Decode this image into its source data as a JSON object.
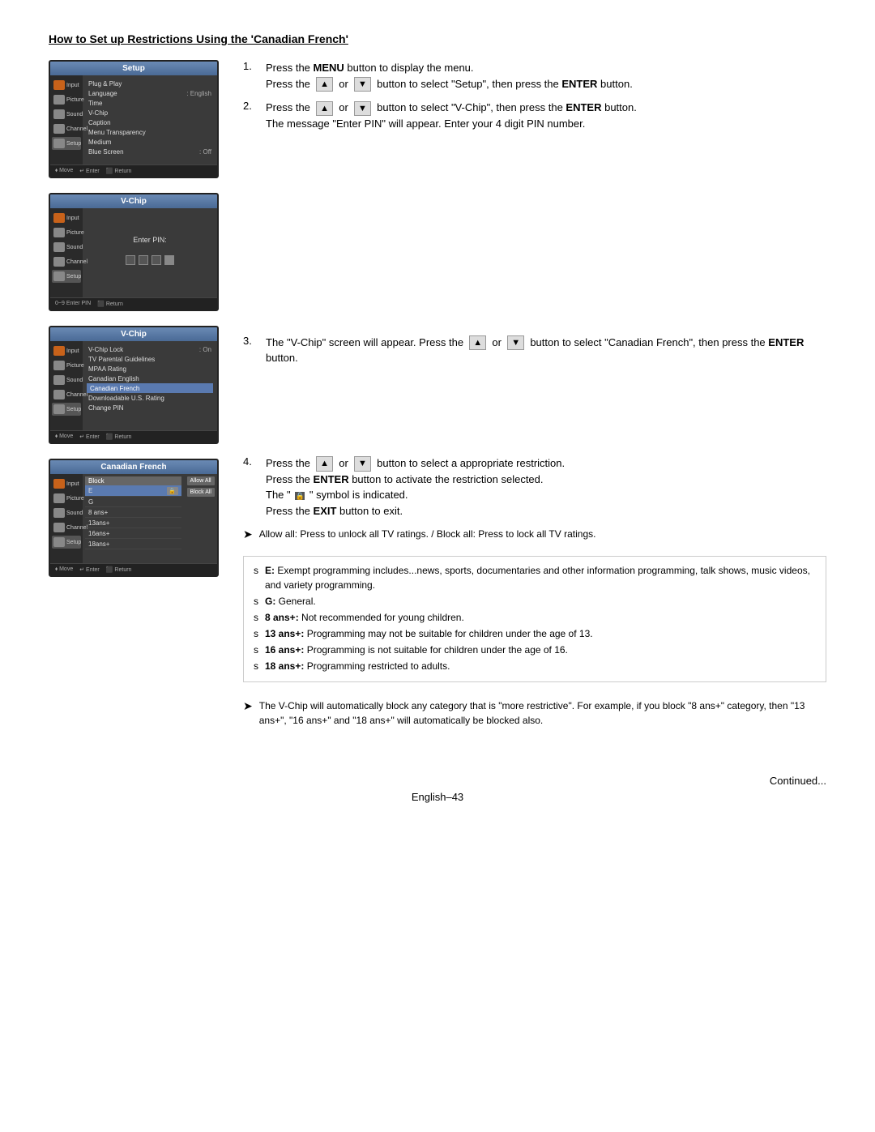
{
  "page": {
    "title": "How to Set up Restrictions Using the 'Canadian French'",
    "footer_continued": "Continued...",
    "footer_page": "English–43"
  },
  "screens": {
    "screen1": {
      "title": "Setup",
      "sidebar_items": [
        {
          "label": "Input",
          "active": false
        },
        {
          "label": "Picture",
          "active": false
        },
        {
          "label": "Sound",
          "active": false
        },
        {
          "label": "Channel",
          "active": false
        },
        {
          "label": "Setup",
          "active": true
        }
      ],
      "menu_items": [
        {
          "text": "Plug & Play",
          "value": ""
        },
        {
          "text": "Language",
          "value": ": English"
        },
        {
          "text": "Time",
          "value": ""
        },
        {
          "text": "V-Chip",
          "value": ""
        },
        {
          "text": "Caption",
          "value": ""
        },
        {
          "text": "Menu Transparency",
          "value": ""
        },
        {
          "text": "Medium",
          "value": ""
        },
        {
          "text": "Blue Screen",
          "value": ": Off"
        }
      ],
      "footer": [
        "⬧ Move",
        "↵ Enter",
        "⬛ Return"
      ]
    },
    "screen2": {
      "title": "V-Chip",
      "label": "Enter PIN:",
      "footer": [
        "0~9 Enter PIN",
        "⬛ Return"
      ]
    },
    "screen3": {
      "title": "V-Chip",
      "sidebar_items": [
        {
          "label": "Input",
          "active": false
        },
        {
          "label": "Picture",
          "active": false
        },
        {
          "label": "Sound",
          "active": false
        },
        {
          "label": "Channel",
          "active": false
        },
        {
          "label": "Setup",
          "active": true
        }
      ],
      "menu_items": [
        {
          "text": "V-Chip Lock",
          "value": ": On"
        },
        {
          "text": "TV Parental Guidelines",
          "value": ""
        },
        {
          "text": "MPAA Rating",
          "value": ""
        },
        {
          "text": "Canadian English",
          "value": ""
        },
        {
          "text": "Canadian French",
          "value": "",
          "highlighted": true
        },
        {
          "text": "Downloadable U.S. Rating",
          "value": ""
        },
        {
          "text": "Change PIN",
          "value": ""
        }
      ],
      "footer": [
        "⬧ Move",
        "↵ Enter",
        "⬛ Return"
      ]
    },
    "screen4": {
      "title": "Canadian French",
      "sidebar_items": [
        {
          "label": "Input",
          "active": false
        },
        {
          "label": "Picture",
          "active": false
        },
        {
          "label": "Sound",
          "active": false
        },
        {
          "label": "Channel",
          "active": false
        },
        {
          "label": "Setup",
          "active": true
        }
      ],
      "block_label": "Block",
      "rows": [
        {
          "label": "E",
          "locked": true,
          "highlighted": true
        },
        {
          "label": "G",
          "locked": false
        },
        {
          "label": "8 ans+",
          "locked": false
        },
        {
          "label": "13ans+",
          "locked": false
        },
        {
          "label": "16ans+",
          "locked": false
        },
        {
          "label": "18ans+",
          "locked": false
        }
      ],
      "buttons": [
        "Allow All",
        "Block All"
      ],
      "footer": [
        "⬧ Move",
        "↵ Enter",
        "⬛ Return"
      ]
    }
  },
  "instructions": {
    "step1": {
      "number": "1.",
      "line1": "Press the MENU button to display the menu.",
      "line2_prefix": "Press the",
      "line2_mid": "or",
      "line2_suffix": "button to select \"Setup\", then press the ENTER button."
    },
    "step2": {
      "number": "2.",
      "line1_prefix": "Press the",
      "line1_mid": "or",
      "line1_suffix": "button to select \"V-Chip\", then press the ENTER button.",
      "line2": "The message \"Enter PIN\" will appear. Enter your 4 digit PIN number."
    },
    "step3": {
      "number": "3.",
      "line1_prefix": "The \"V-Chip\" screen will appear. Press the",
      "line1_mid": "or",
      "line1_suffix": "button to select \"Canadian French\", then press the ENTER button."
    },
    "step4": {
      "number": "4.",
      "line1_prefix": "Press the",
      "line1_mid": "or",
      "line1_suffix": "button to select a appropriate restriction.",
      "line2": "Press the ENTER button to activate the restriction selected.",
      "line3_prefix": "The \"",
      "line3_suffix": "\" symbol is indicated.",
      "line4": "Press the EXIT button to exit."
    },
    "note1": "Allow all: Press to unlock all TV ratings. / Block all: Press to lock all TV ratings.",
    "info_items": [
      {
        "bullet": "s",
        "label": "E:",
        "bold": true,
        "text": " Exempt programming includes...news, sports, documentaries and other information programming, talk shows, music videos, and variety programming."
      },
      {
        "bullet": "s",
        "label": "G:",
        "bold": true,
        "text": " General."
      },
      {
        "bullet": "s",
        "label": "8 ans+:",
        "bold": true,
        "text": " Not recommended for young children."
      },
      {
        "bullet": "s",
        "label": "13 ans+:",
        "bold": true,
        "text": " Programming may not be suitable for children under the age of 13."
      },
      {
        "bullet": "s",
        "label": "16 ans+:",
        "bold": true,
        "text": " Programming is not suitable for children under the age of 16."
      },
      {
        "bullet": "s",
        "label": "18 ans+:",
        "bold": true,
        "text": " Programming restricted to adults."
      }
    ],
    "note2": "The V-Chip will automatically block any category that is \"more restrictive\". For example, if you block \"8 ans+\" category, then \"13 ans+\", \"16 ans+\" and \"18 ans+\" will automatically be blocked also."
  }
}
